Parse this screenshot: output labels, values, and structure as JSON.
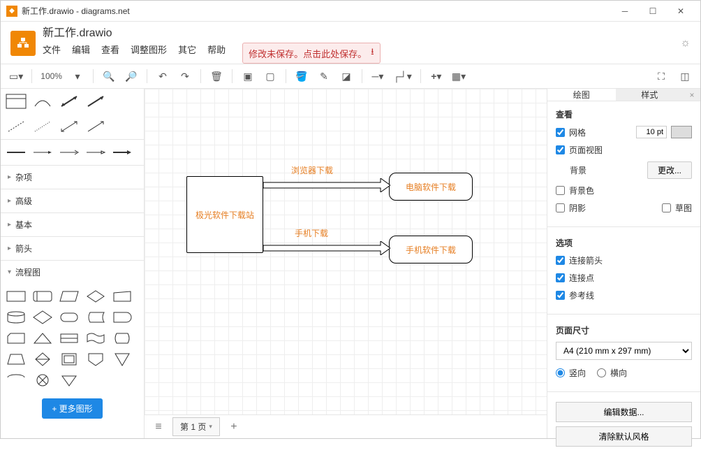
{
  "titlebar": {
    "title": "新工作.drawio - diagrams.net"
  },
  "doc": {
    "title": "新工作.drawio"
  },
  "menus": {
    "file": "文件",
    "edit": "编辑",
    "view": "查看",
    "adjust": "调整图形",
    "other": "其它",
    "help": "帮助"
  },
  "save_warning": "修改未保存。点击此处保存。",
  "toolbar": {
    "zoom": "100%"
  },
  "sidebar": {
    "categories": {
      "misc": "杂项",
      "advanced": "高级",
      "basic": "基本",
      "arrows": "箭头",
      "flowchart": "流程图"
    },
    "more_shapes": "+ 更多图形"
  },
  "canvas": {
    "nodes": {
      "main": "极光软件下载站",
      "desktop": "电脑软件下载",
      "mobile": "手机软件下载"
    },
    "edge_labels": {
      "browser": "浏览器下载",
      "phone": "手机下载"
    }
  },
  "pages": {
    "tab1": "第 1 页"
  },
  "rightpanel": {
    "tabs": {
      "diagram": "绘图",
      "style": "样式"
    },
    "view_section": "查看",
    "grid_label": "网格",
    "grid_size": "10 pt",
    "pageview_label": "页面视图",
    "background_label": "背景",
    "change_btn": "更改...",
    "bgcolor_label": "背景色",
    "shadow_label": "阴影",
    "draft_label": "草图",
    "options_section": "选项",
    "conn_arrows": "连接箭头",
    "conn_points": "连接点",
    "guides": "参考线",
    "pagesize_section": "页面尺寸",
    "pagesize_value": "A4 (210 mm x 297 mm)",
    "portrait": "竖向",
    "landscape": "横向",
    "edit_data_btn": "编辑数据...",
    "clear_style_btn": "清除默认风格"
  }
}
